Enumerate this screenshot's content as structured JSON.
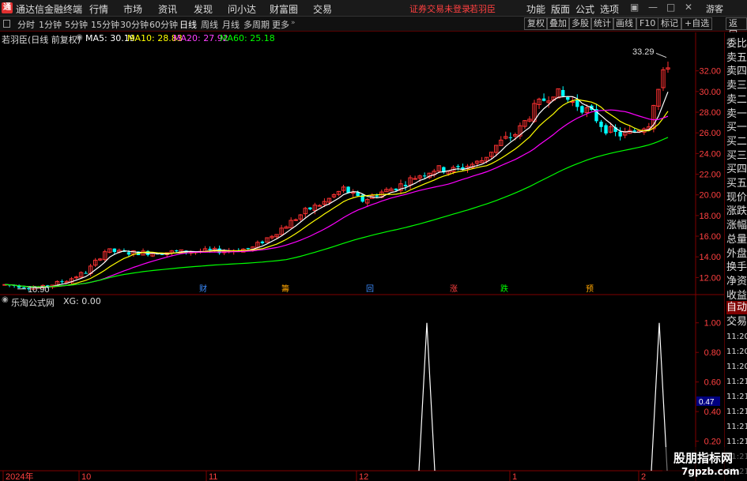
{
  "titlebar": {
    "app_name": "通达信金融终端",
    "menus": [
      "行情",
      "市场",
      "资讯",
      "发现",
      "问小达",
      "财富圈",
      "交易"
    ],
    "notice": "证券交易未登录",
    "stock_name": "若羽臣",
    "tools": [
      "功能",
      "版面",
      "公式",
      "选项"
    ],
    "guest": "游客",
    "logo_char": "通"
  },
  "periods": [
    "分时",
    "1分钟",
    "5分钟",
    "15分钟",
    "30分钟",
    "60分钟",
    "日线",
    "周线",
    "月线",
    "多周期",
    "更多"
  ],
  "active_period": "日线",
  "right_buttons": [
    "复权",
    "叠加",
    "多股",
    "统计",
    "画线",
    "F10",
    "标记",
    "+自选",
    "返回"
  ],
  "main_header": {
    "title": "若羽臣(日线 前复权)",
    "ma5": "MA5: 30.19",
    "ma10": "MA10: 28.83",
    "ma20": "MA20: 27.92",
    "ma60": "MA60: 25.18"
  },
  "indicator_header": {
    "name": "乐淘公式网",
    "value": "XG: 0.00"
  },
  "annotations": {
    "high": "33.29",
    "low": "10.90"
  },
  "event_markers": [
    "财",
    "籌",
    "回",
    "涨",
    "跌",
    "预"
  ],
  "right_panel_items": [
    "委比",
    "卖五",
    "卖四",
    "卖三",
    "卖二",
    "卖一",
    "买一",
    "买二",
    "买三",
    "买四",
    "买五",
    "现价",
    "涨跌",
    "涨幅",
    "总量",
    "外盘",
    "换手",
    "净资",
    "收益"
  ],
  "right_panel_bottom": [
    "自动",
    "交易",
    "11:20",
    "11:20",
    "11:20",
    "11:21",
    "11:21",
    "11:21",
    "11:21",
    "11:21",
    "11:21",
    "11:21"
  ],
  "chart_data": [
    {
      "type": "candlestick",
      "title": "若羽臣(日线 前复权)",
      "y_ticks": [
        "32.00",
        "30.00",
        "28.00",
        "26.00",
        "24.00",
        "22.00",
        "20.00",
        "18.00",
        "16.00",
        "14.00",
        "12.00"
      ],
      "ylim": [
        10.5,
        34.5
      ],
      "x_ticks": [
        "2024年",
        "10",
        "11",
        "12",
        "1",
        "2"
      ],
      "colors": {
        "up": "#ff3232",
        "down": "#00ffff",
        "ma5": "#ffffff",
        "ma10": "#ffff00",
        "ma20": "#ff00ff",
        "ma60": "#00ff00"
      }
    },
    {
      "type": "line",
      "title": "乐淘公式网",
      "series_name": "XG",
      "y_ticks": [
        "1.00",
        "0.80",
        "0.60",
        "0.47",
        "0.40",
        "0.20"
      ],
      "ylim": [
        0,
        1.1
      ],
      "current_value": "0.47",
      "color": "#ffffff"
    }
  ]
}
